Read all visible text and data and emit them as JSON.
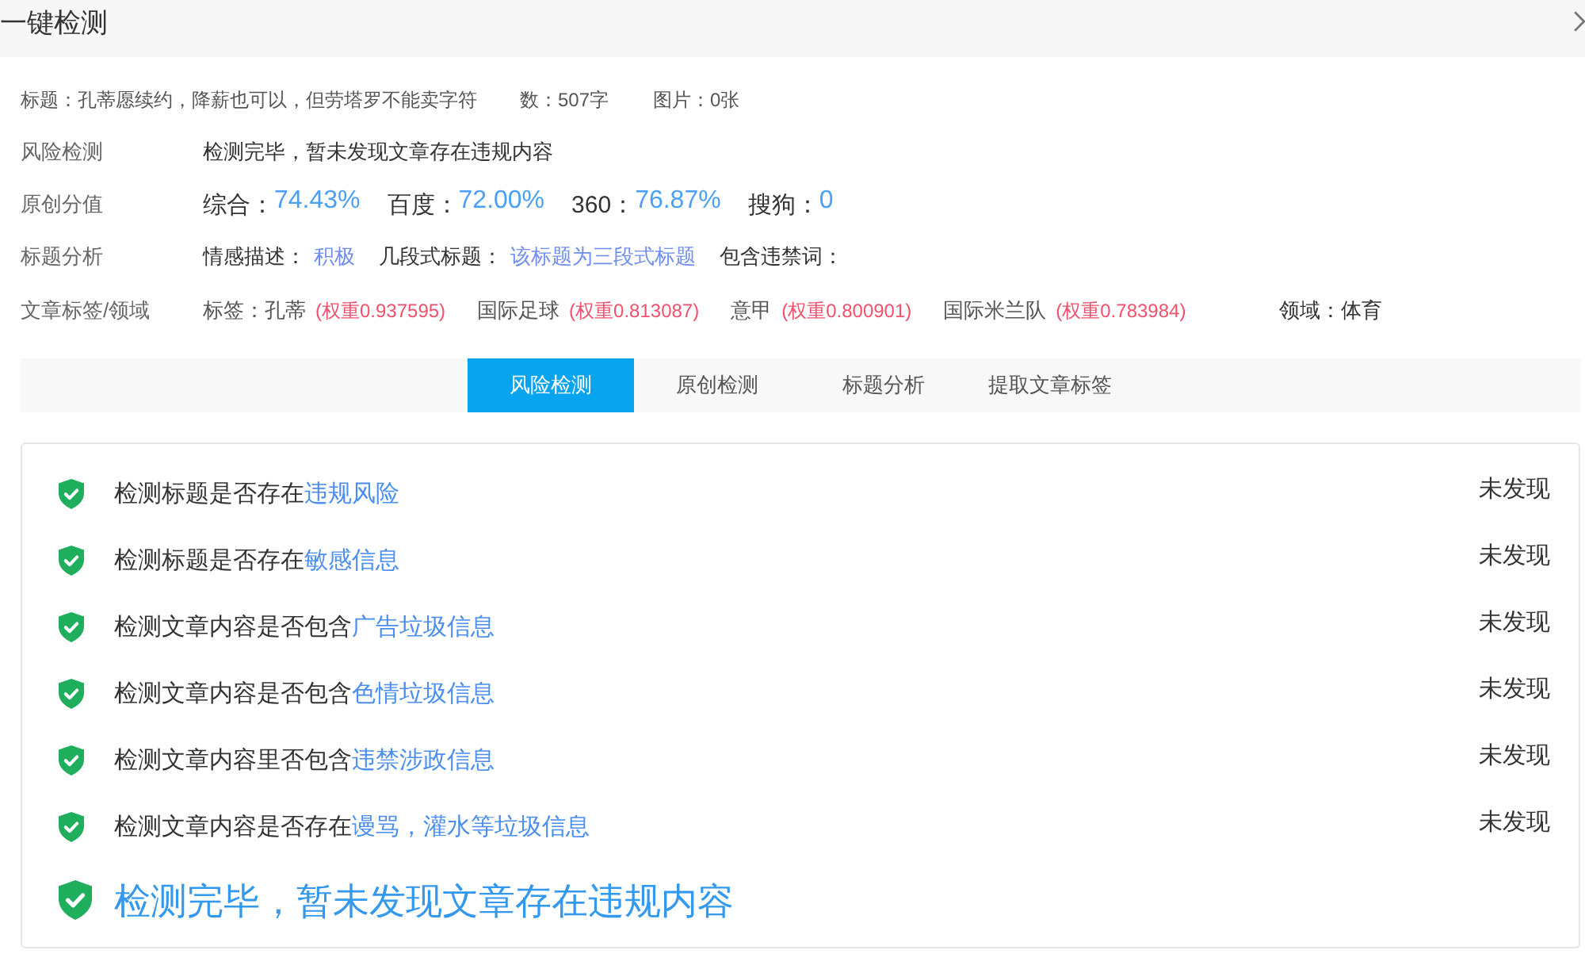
{
  "dialog": {
    "title": "一键检测"
  },
  "summary": {
    "title": "标题：孔蒂愿续约，降薪也可以，但劳塔罗不能卖字符",
    "word_count": "数：507字",
    "images": "图片：0张"
  },
  "info_rows": [
    {
      "kind": "text",
      "label": "风险检测",
      "value": "检测完毕，暂未发现文章存在违规内容"
    },
    {
      "kind": "scores",
      "label": "原创分值",
      "scores": [
        {
          "name": "综合：",
          "value": "74.43%"
        },
        {
          "name": "百度：",
          "value": "72.00%"
        },
        {
          "name": "360：",
          "value": "76.87%"
        },
        {
          "name": "搜狗：",
          "value": "0"
        }
      ]
    },
    {
      "kind": "fields",
      "label": "标题分析",
      "fields": [
        {
          "name": "情感描述：",
          "value": "积极"
        },
        {
          "name": "几段式标题：",
          "value": "该标题为三段式标题"
        },
        {
          "name": "包含违禁词："
        }
      ]
    },
    {
      "kind": "tags",
      "label": "文章标签/领域",
      "prefix": "标签：",
      "tags": [
        {
          "name": "孔蒂",
          "weight": "(权重0.937595)"
        },
        {
          "name": "国际足球",
          "weight": "(权重0.813087)"
        },
        {
          "name": "意甲",
          "weight": "(权重0.800901)"
        },
        {
          "name": "国际米兰队",
          "weight": "(权重0.783984)"
        }
      ],
      "domain": "领域：体育"
    }
  ],
  "tabs": [
    {
      "label": "风险检测",
      "selected": true
    },
    {
      "label": "原创检测",
      "selected": false
    },
    {
      "label": "标题分析",
      "selected": false
    },
    {
      "label": "提取文章标签",
      "selected": false
    }
  ],
  "checks": [
    {
      "text": "检测标题是否存在",
      "highlight": "违规风险",
      "result": "未发现"
    },
    {
      "text": "检测标题是否存在",
      "highlight": "敏感信息",
      "result": "未发现"
    },
    {
      "text": "检测文章内容是否包含",
      "highlight": "广告垃圾信息",
      "result": "未发现"
    },
    {
      "text": "检测文章内容是否包含",
      "highlight": "色情垃圾信息",
      "result": "未发现"
    },
    {
      "text": "检测文章内容里否包含",
      "highlight": "违禁涉政信息",
      "result": "未发现"
    },
    {
      "text": "检测文章内容是否存在",
      "highlight": "谩骂，灌水等垃圾信息",
      "result": "未发现"
    }
  ],
  "conclusion": "检测完毕，暂未发现文章存在违规内容"
}
